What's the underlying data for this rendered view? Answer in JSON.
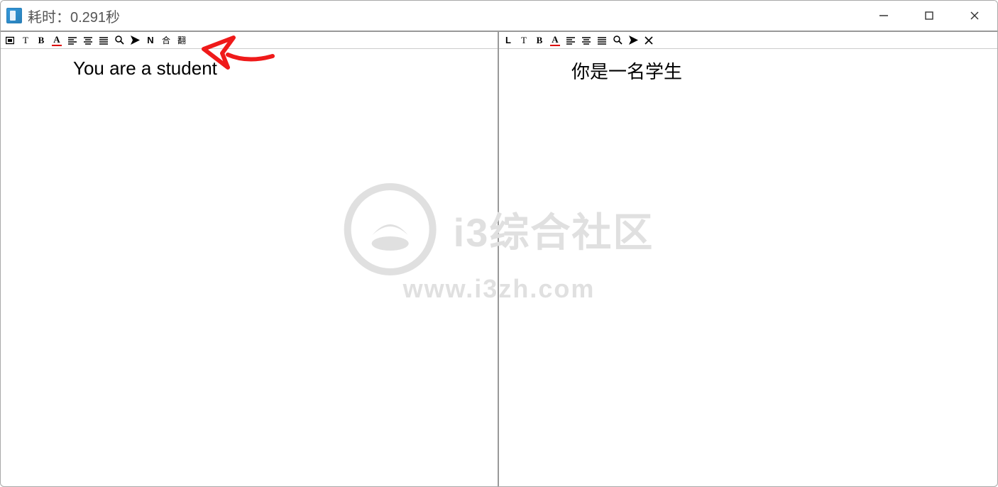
{
  "window": {
    "title": "耗时：0.291秒"
  },
  "toolbar": {
    "left": {
      "layout_glyph": "▣",
      "text_glyph": "T",
      "bold_glyph": "B",
      "underline_glyph": "A",
      "n_glyph": "N",
      "merge_glyph": "合",
      "translate_glyph": "翻"
    },
    "right": {
      "layout_glyph": "L",
      "text_glyph": "T",
      "bold_glyph": "B",
      "underline_glyph": "A"
    }
  },
  "panes": {
    "left": {
      "text": "You are a student"
    },
    "right": {
      "text": "你是一名学生"
    }
  },
  "watermark": {
    "brand": "i3综合社区",
    "url": "www.i3zh.com"
  }
}
